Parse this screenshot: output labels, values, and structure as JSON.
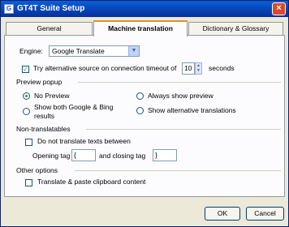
{
  "window": {
    "title": "GT4T Suite Setup",
    "app_icon": "G",
    "close_glyph": "×"
  },
  "tabs": [
    {
      "label": "General"
    },
    {
      "label": "Machine translation"
    },
    {
      "label": "Dictionary & Glossary"
    }
  ],
  "engine": {
    "label": "Engine:",
    "value": "Google Translate",
    "arrow": "▼"
  },
  "alt_source": {
    "label": "Try alternative source on connection timeout of",
    "checked": true,
    "timeout_value": "10",
    "unit": "seconds"
  },
  "preview_popup": {
    "section": "Preview popup",
    "no_preview": "No Preview",
    "always_show": "Always show preview",
    "show_both_line1": "Show both Google & Bing",
    "show_both_line2": "results",
    "show_alternative": "Show alternative translations",
    "selected": "No Preview"
  },
  "non_translatables": {
    "section": "Non-translatables",
    "do_not_translate": "Do not translate texts between",
    "opening_label": "Opening tag",
    "opening_value": "{",
    "closing_label": "and closing tag",
    "closing_value": "}"
  },
  "other_options": {
    "section": "Other options",
    "translate_paste": "Translate & paste clipboard content"
  },
  "buttons": {
    "ok": "OK",
    "cancel": "Cancel"
  },
  "glyphs": {
    "check": "✓",
    "up": "▲",
    "down": "▼"
  }
}
